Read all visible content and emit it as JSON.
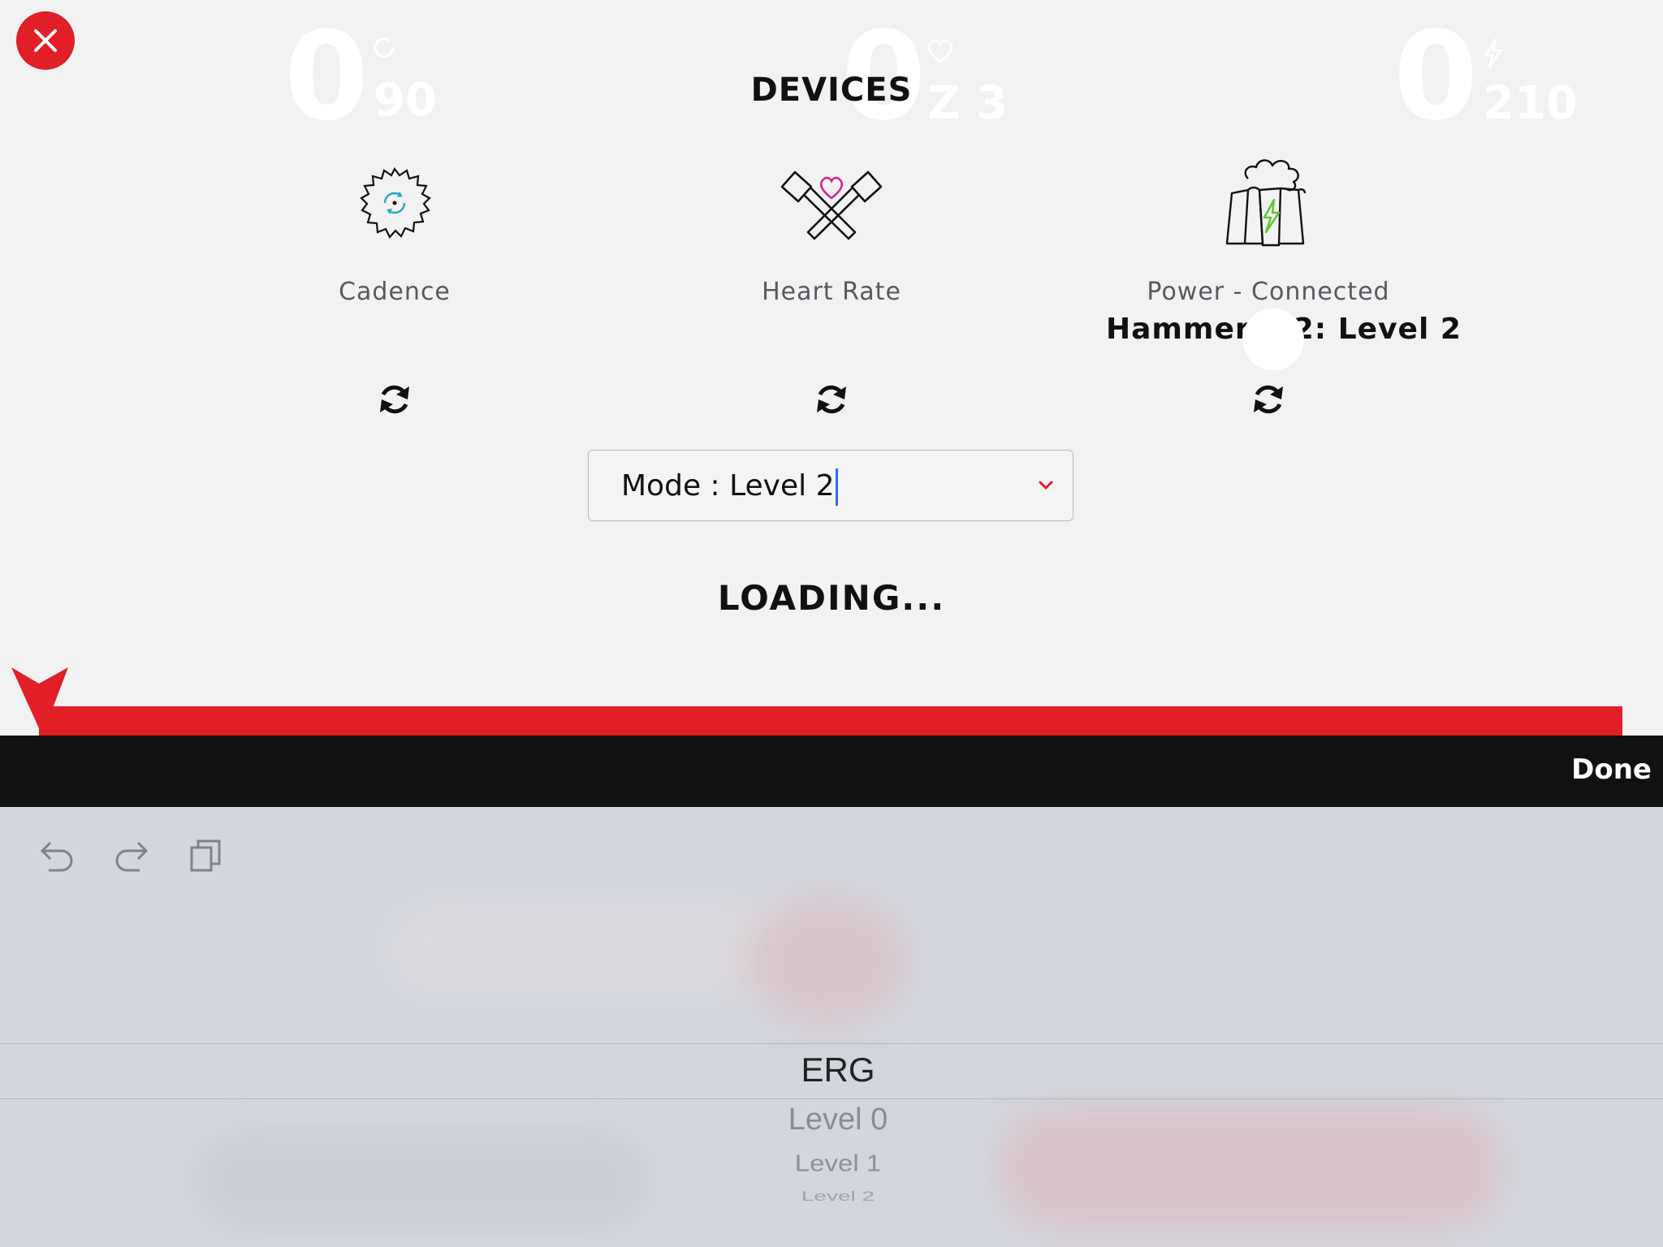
{
  "header": {
    "title": "DEVICES"
  },
  "background_metrics": [
    {
      "value": "0",
      "secondary": "90",
      "icon": "cadence-icon"
    },
    {
      "value": "0",
      "secondary": "Z 3",
      "icon": "heart-icon"
    },
    {
      "value": "0",
      "secondary": "210",
      "icon": "bolt-icon"
    }
  ],
  "devices": [
    {
      "label": "Cadence",
      "subtitle": "",
      "icon": "saw-blade-icon"
    },
    {
      "label": "Heart Rate",
      "subtitle": "",
      "icon": "crossed-hammers-heart-icon"
    },
    {
      "label": "Power - Connected",
      "subtitle": "Hammer 4    2: Level 2",
      "icon": "power-plant-icon"
    }
  ],
  "mode_select": {
    "value": "Mode : Level 2"
  },
  "status": {
    "loading": "LOADING..."
  },
  "keyboard_bar": {
    "done_label": "Done"
  },
  "picker": {
    "items": [
      "ERG",
      "Level 0",
      "Level 1",
      "Level 2"
    ],
    "selected": "ERG"
  },
  "colors": {
    "accent": "#e11f26",
    "bar": "#111111",
    "cadence_icon": "#2aa7c9",
    "heart_icon": "#d6278a",
    "power_bolt": "#6ac23a"
  }
}
